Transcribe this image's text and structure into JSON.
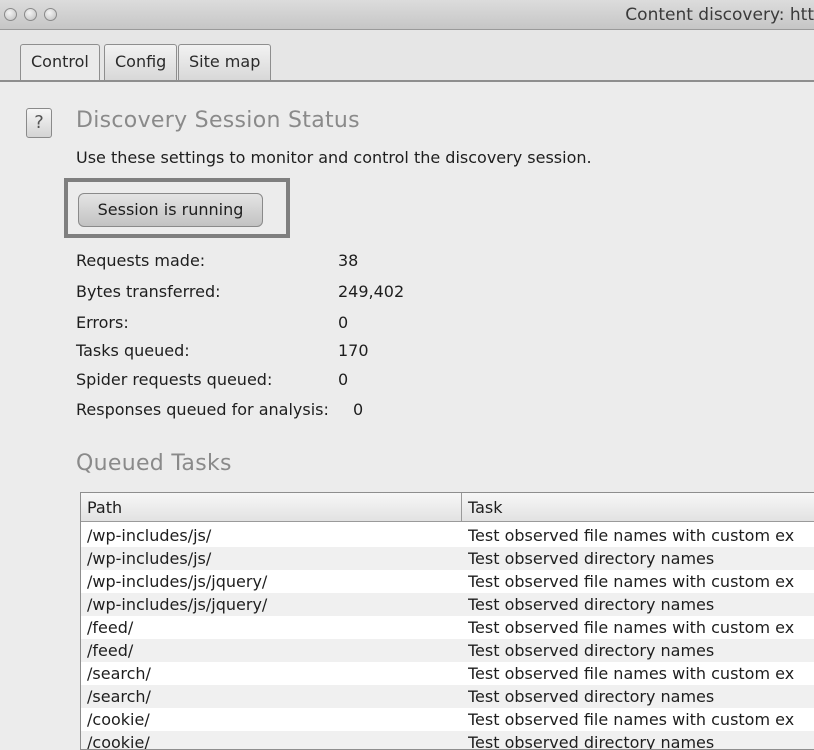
{
  "window": {
    "title": "Content discovery: htt"
  },
  "tabs": [
    {
      "label": "Control"
    },
    {
      "label": "Config"
    },
    {
      "label": "Site map"
    }
  ],
  "help_icon_label": "?",
  "status": {
    "title": "Discovery Session Status",
    "description": "Use these settings to monitor and control the discovery session.",
    "button_label": "Session is running"
  },
  "stats": [
    {
      "label": "Requests made:",
      "value": "38"
    },
    {
      "label": "Bytes transferred:",
      "value": "249,402"
    },
    {
      "label": "Errors:",
      "value": "0"
    },
    {
      "label": "Tasks queued:",
      "value": "170"
    },
    {
      "label": "Spider requests queued:",
      "value": "0"
    },
    {
      "label": "Responses queued for analysis:",
      "value": "0"
    }
  ],
  "queued": {
    "title": "Queued Tasks",
    "columns": [
      "Path",
      "Task"
    ],
    "rows": [
      {
        "path": "/wp-includes/js/",
        "task": "Test observed file names with custom ex"
      },
      {
        "path": "/wp-includes/js/",
        "task": "Test observed directory names"
      },
      {
        "path": "/wp-includes/js/jquery/",
        "task": "Test observed file names with custom ex"
      },
      {
        "path": "/wp-includes/js/jquery/",
        "task": "Test observed directory names"
      },
      {
        "path": "/feed/",
        "task": "Test observed file names with custom ex"
      },
      {
        "path": "/feed/",
        "task": "Test observed directory names"
      },
      {
        "path": "/search/",
        "task": "Test observed file names with custom ex"
      },
      {
        "path": "/search/",
        "task": "Test observed directory names"
      },
      {
        "path": "/cookie/",
        "task": "Test observed file names with custom ex"
      },
      {
        "path": "/cookie/",
        "task": "Test observed directory names"
      }
    ]
  }
}
